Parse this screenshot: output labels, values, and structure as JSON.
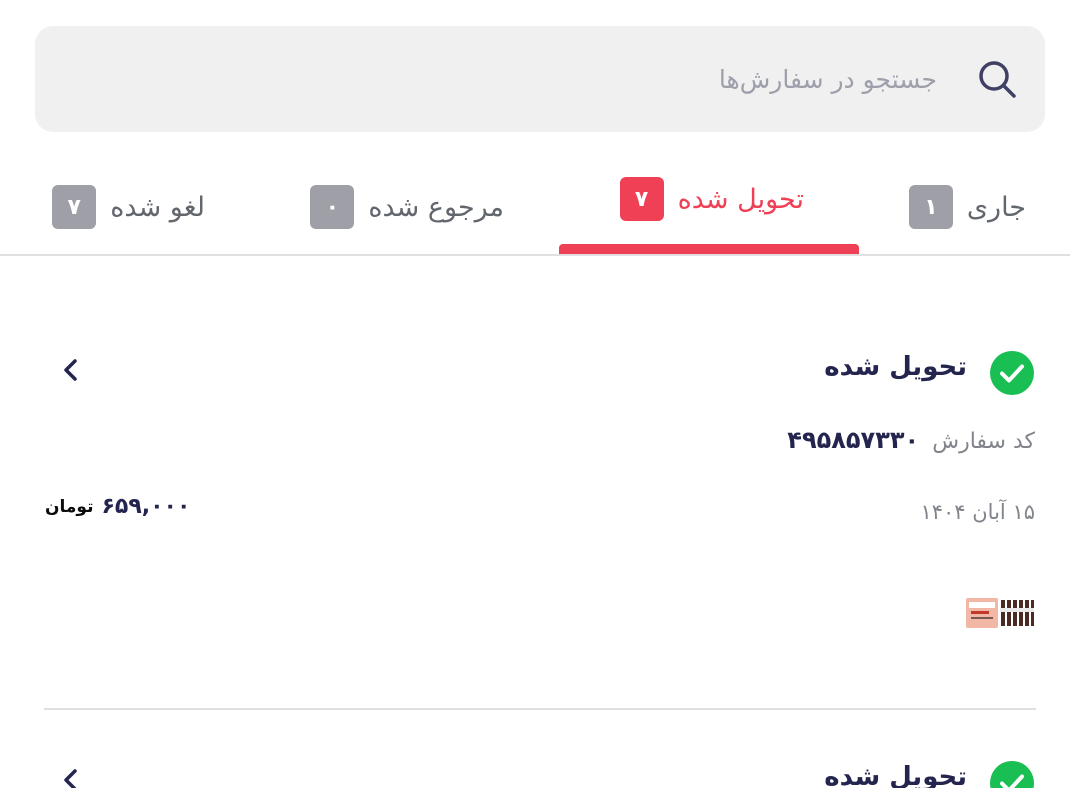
{
  "search": {
    "placeholder": "جستجو در سفارش‌ها",
    "icon": "search-icon"
  },
  "tabs": [
    {
      "label": "جاری",
      "count": "۱",
      "active": false
    },
    {
      "label": "تحویل شده",
      "count": "۷",
      "active": true
    },
    {
      "label": "مرجوع شده",
      "count": "۰",
      "active": false
    },
    {
      "label": "لغو شده",
      "count": "۷",
      "active": false
    }
  ],
  "colors": {
    "accent": "#ef4056",
    "success": "#19bf53",
    "badge_inactive": "#9e9fa7",
    "search_bg": "#f0f0f1"
  },
  "orders": [
    {
      "status": "تحویل شده",
      "code_label": "کد سفارش",
      "code": "۴۹۵۸۵۷۳۳۰",
      "date": "۱۵ آبان ۱۴۰۴",
      "price": "۶۵۹,۰۰۰",
      "currency": "تومان",
      "thumbnail": "product-thumbnail"
    },
    {
      "status": "تحویل شده"
    }
  ]
}
